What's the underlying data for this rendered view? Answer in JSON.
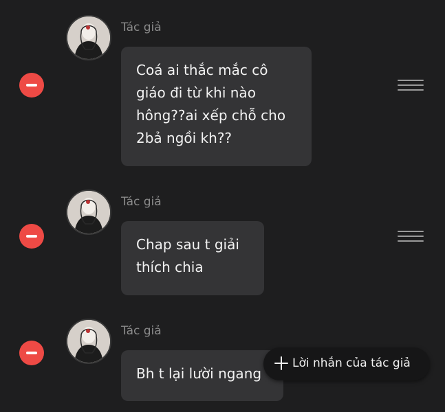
{
  "colors": {
    "background": "#1e1e1f",
    "bubble": "#343436",
    "remove_button": "#ee4a45",
    "author_label": "#8a8a8a",
    "text": "#f2f2f2"
  },
  "messages": [
    {
      "author_label": "Tác giả",
      "text": "Coá ai thắc mắc cô\ngiáo đi từ khi nào\nhông??ai xếp chỗ cho\n2bả ngồi kh??",
      "remove_icon": "minus-circle-icon",
      "drag_icon": "drag-handle-icon"
    },
    {
      "author_label": "Tác giả",
      "text": "Chap sau t giải\nthích chia",
      "remove_icon": "minus-circle-icon",
      "drag_icon": "drag-handle-icon"
    },
    {
      "author_label": "Tác giả",
      "text": "Bh t lại lười ngang",
      "remove_icon": "minus-circle-icon"
    }
  ],
  "add_note_button": {
    "icon": "plus-icon",
    "label": "Lời nhắn của tác giả"
  }
}
